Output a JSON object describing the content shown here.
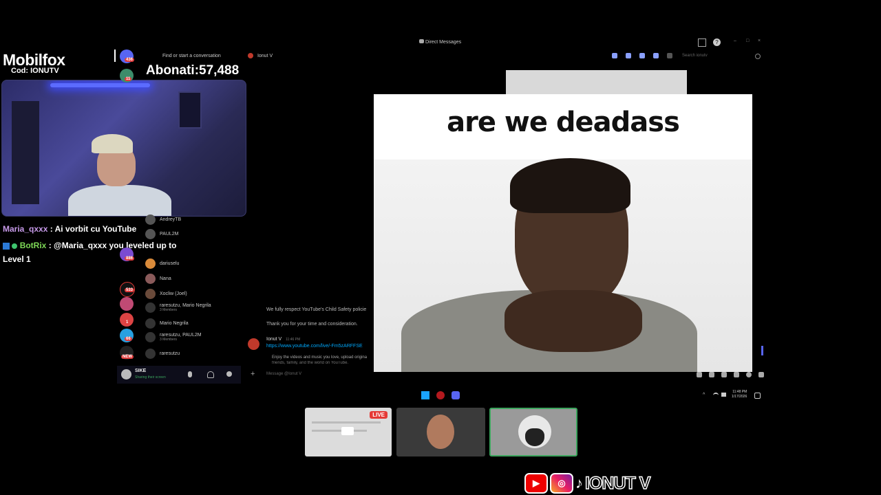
{
  "overlay": {
    "brand": "Mobilfox",
    "code": "Cod: IONUTV",
    "subscribers_label": "Abonati:",
    "subscribers_value": "57,488"
  },
  "chat": [
    {
      "name": "Maria_qxxx",
      "text": ": Ai vorbit cu YouTube"
    },
    {
      "name": "BotRix",
      "text": ": @Maria_qxxx you leveled up to"
    },
    {
      "name": "",
      "text": "Level 1"
    }
  ],
  "discord": {
    "window_title": "Direct Messages",
    "find_conversation": "Find or start a conversation",
    "dm_header_name": "Ionut V",
    "search_placeholder": "Search ionutv",
    "guild_badges": [
      "436",
      "11",
      "886",
      "533",
      "1",
      "66",
      "NEW"
    ],
    "dm_list": [
      {
        "name": "AndreyTB",
        "sub": ""
      },
      {
        "name": "PAUL2M",
        "sub": ""
      },
      {
        "name": "dariuselu",
        "sub": ""
      },
      {
        "name": "Nana",
        "sub": ""
      },
      {
        "name": "Xocliw (Joel)",
        "sub": ""
      },
      {
        "name": "raresutzu, Mario Negrila",
        "sub": "3 Members"
      },
      {
        "name": "Mario Negrila",
        "sub": ""
      },
      {
        "name": "raresutzu, PAUL2M",
        "sub": "3 Members"
      },
      {
        "name": "raresutzu",
        "sub": ""
      }
    ],
    "messages": {
      "line1": "We fully respect YouTube's Child Safety policie",
      "line2": "Thank you for your time and consideration.",
      "author": "Ionut V",
      "time": "11:46 PM",
      "link": "https://www.youtube.com/live/-Fm5zARFFSE",
      "embed_line1": "Enjoy the videos and music you love, upload origina",
      "embed_line2": "friends, family, and the world on YouTube."
    },
    "input_placeholder": "Message @Ionut V",
    "user": {
      "name": "SIKE",
      "status": "Sharing their screen"
    }
  },
  "meme": {
    "caption": "are we deadass"
  },
  "taskbar": {
    "time": "11:48 PM",
    "date": "1/17/2026"
  },
  "stream_thumbs": {
    "live_label": "LIVE"
  },
  "social": {
    "handle": "IONUT V"
  },
  "colors": {
    "accent_live": "#e53935",
    "chat_name_1": "#c79ae9",
    "chat_name_2": "#7ed957"
  }
}
